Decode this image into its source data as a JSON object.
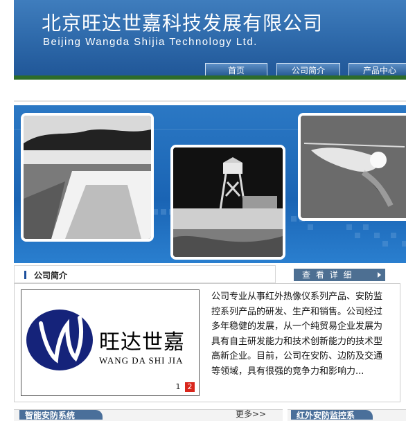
{
  "header": {
    "title_cn": "北京旺达世嘉科技发展有限公司",
    "title_en": "Beijing Wangda Shijia Technology Ltd."
  },
  "nav": {
    "items": [
      {
        "label": "首页"
      },
      {
        "label": "公司简介"
      },
      {
        "label": "产品中心"
      }
    ]
  },
  "about": {
    "section_title": "公司简介",
    "more_button": "查 看 详 细",
    "logo_cn": "旺达世嘉",
    "logo_en": "WANG DA SHI JIA",
    "pages": [
      "1",
      "2"
    ],
    "description": "公司专业从事红外热像仪系列产品、安防监控系列产品的研发、生产和销售。公司经过多年稳健的发展，从一个纯贸易企业发展为具有自主研发能力和技术创新能力的技术型高新企业。目前，公司在安防、边防及交通等领域，具有很强的竞争力和影响力..."
  },
  "bottom": {
    "left_tab": "智能安防系统",
    "more_link": "更多>>",
    "right_tab": "红外安防监控系"
  },
  "colors": {
    "header_blue": "#2c67a8",
    "header_green_line": "#2d6c2a",
    "logo_navy": "#15237a",
    "page_active": "#d9261c"
  }
}
